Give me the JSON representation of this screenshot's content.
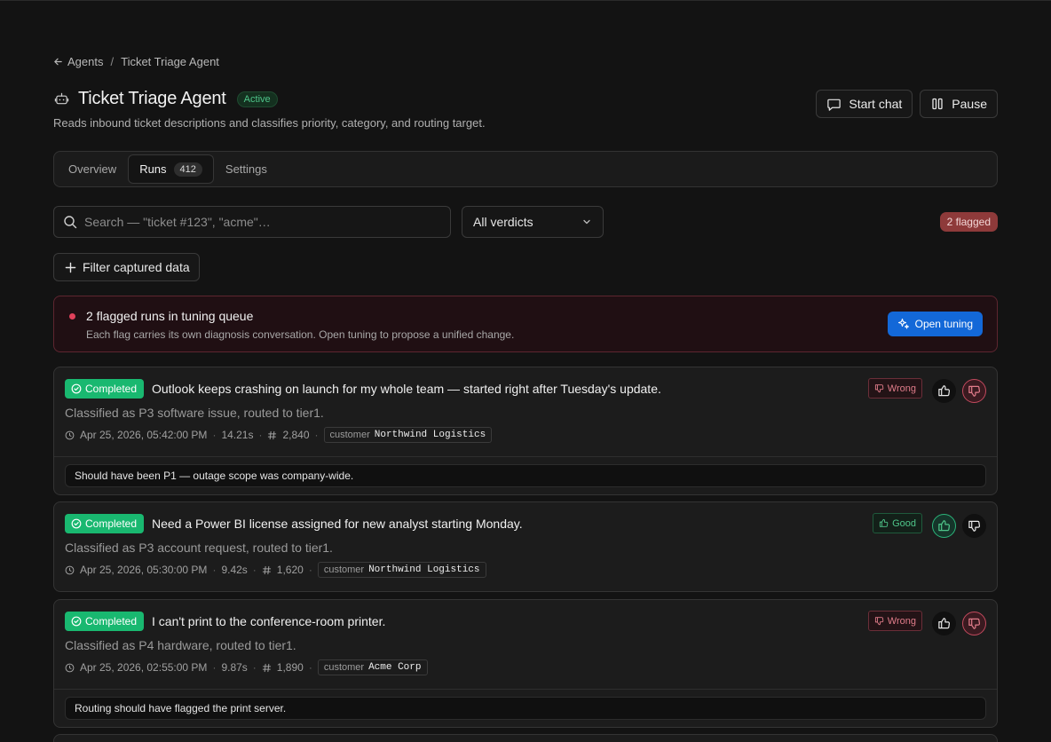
{
  "breadcrumb": {
    "back": "Agents",
    "separator": "/",
    "current": "Ticket Triage Agent"
  },
  "agent": {
    "name": "Ticket Triage Agent",
    "status": "Active",
    "description": "Reads inbound ticket descriptions and classifies priority, category, and routing target."
  },
  "actions": {
    "start_chat": "Start chat",
    "pause": "Pause"
  },
  "tabs": [
    {
      "label": "Overview"
    },
    {
      "label": "Runs",
      "count": "412"
    },
    {
      "label": "Settings"
    }
  ],
  "search": {
    "placeholder": "Search — \"ticket #123\", \"acme\"…"
  },
  "verdict_filter": {
    "selected": "All verdicts"
  },
  "flagged_count": "2 flagged",
  "filter_button": "Filter captured data",
  "alert": {
    "title": "2 flagged runs in tuning queue",
    "subtitle": "Each flag carries its own diagnosis conversation. Open tuning to propose a unified change.",
    "button": "Open tuning"
  },
  "runs": [
    {
      "status": "Completed",
      "title": "Outlook keeps crashing on launch for my whole team — started right after Tuesday's update.",
      "classification": "Classified as P3 software issue, routed to tier1.",
      "timestamp": "Apr 25, 2026, 05:42:00 PM",
      "duration": "14.21s",
      "tokens": "2,840",
      "customer_label": "customer",
      "customer": "Northwind Logistics",
      "verdict": "Wrong",
      "note": "Should have been P1 — outage scope was company-wide."
    },
    {
      "status": "Completed",
      "title": "Need a Power BI license assigned for new analyst starting Monday.",
      "classification": "Classified as P3 account request, routed to tier1.",
      "timestamp": "Apr 25, 2026, 05:30:00 PM",
      "duration": "9.42s",
      "tokens": "1,620",
      "customer_label": "customer",
      "customer": "Northwind Logistics",
      "verdict": "Good"
    },
    {
      "status": "Completed",
      "title": "I can't print to the conference-room printer.",
      "classification": "Classified as P4 hardware, routed to tier1.",
      "timestamp": "Apr 25, 2026, 02:55:00 PM",
      "duration": "9.87s",
      "tokens": "1,890",
      "customer_label": "customer",
      "customer": "Acme Corp",
      "verdict": "Wrong",
      "note": "Routing should have flagged the print server."
    }
  ],
  "colors": {
    "accent_blue": "#1368d8",
    "completed_green": "#19b870",
    "wrong_red": "#e07c8a",
    "good_green": "#4fc58a"
  },
  "icons": [
    "arrow-left-icon",
    "robot-icon",
    "chat-icon",
    "pause-icon",
    "search-icon",
    "chevron-down-icon",
    "plus-icon",
    "sparkle-icon",
    "check-circle-icon",
    "clock-icon",
    "hash-icon",
    "thumbs-up-icon",
    "thumbs-down-icon"
  ]
}
